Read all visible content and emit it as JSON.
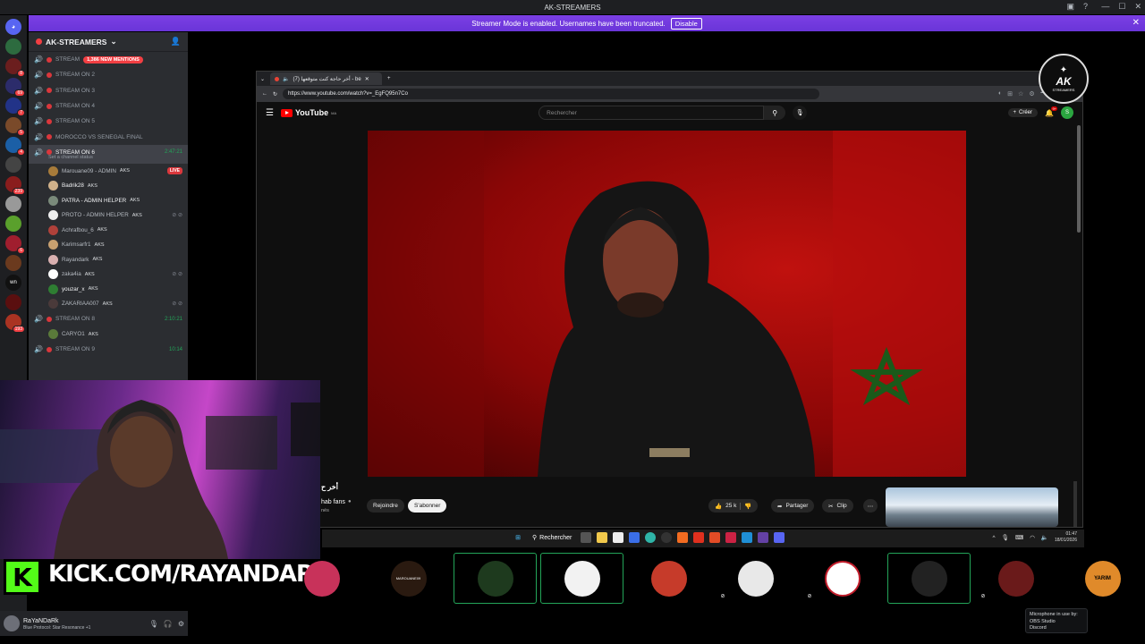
{
  "window": {
    "title": "AK-STREAMERS"
  },
  "banner": {
    "text": "Streamer Mode is enabled. Usernames have been truncated.",
    "button": "Disable"
  },
  "rail": {
    "badges": [
      "8",
      "8",
      "69",
      "7",
      "5",
      "4",
      "239",
      "6",
      "8",
      "wn",
      "193"
    ]
  },
  "server": {
    "name": "AK-STREAMERS"
  },
  "channels": [
    {
      "label": "STREAM",
      "mention": "1,386 NEW MENTIONS"
    },
    {
      "label": "STREAM ON 2"
    },
    {
      "label": "STREAM ON 3"
    },
    {
      "label": "STREAM ON 4"
    },
    {
      "label": "STREAM ON 5"
    },
    {
      "label": "MOROCCO VS SENEGAL FINAL"
    },
    {
      "label": "STREAM ON 6",
      "time": "2:47:21",
      "status": "Set a channel status"
    }
  ],
  "voice_users": [
    {
      "name": "Marouane09 - ADMIN",
      "tag": "AKS",
      "live": "LIVE"
    },
    {
      "name": "Badrik28",
      "tag": "AKS"
    },
    {
      "name": "PATRA - ADMIN HELPER",
      "tag": "AKS"
    },
    {
      "name": "PROTO - ADMIN HELPER",
      "tag": "AKS"
    },
    {
      "name": "Achrafbou_6",
      "tag": "AKS"
    },
    {
      "name": "Karimsarfr1",
      "tag": "AKS"
    },
    {
      "name": "Rayandark",
      "tag": "AKS"
    },
    {
      "name": "zaka4ia",
      "tag": "AKS"
    },
    {
      "name": "youzar_x",
      "tag": "AKS"
    },
    {
      "name": "ZAKARIAA007",
      "tag": "AKS"
    }
  ],
  "channels2": [
    {
      "label": "STREAM ON 8",
      "time": "2:10:21"
    },
    {
      "user": "CARYO1",
      "tag": "AKS"
    },
    {
      "label": "STREAM ON 9",
      "time": "10:14"
    }
  ],
  "browser": {
    "tab_title": "أخر حاجة كنت متوقعها (7) - be",
    "url": "https://www.youtube.com/watch?v=_EgFQ95n7Co"
  },
  "youtube": {
    "logo": "YouTube",
    "region": "MA",
    "search_placeholder": "Rechercher",
    "create": "Créer",
    "notif_count": "9+",
    "avatar_letter": "S",
    "video_title_fragment": "أخر ح",
    "channel": "hab fans",
    "channel_sub": "nés",
    "join": "Rejoindre",
    "subscribe": "S'abonner",
    "likes": "25 k",
    "share": "Partager",
    "clip": "Clip"
  },
  "ak_logo": {
    "big": "AK",
    "small": "STREAMERS"
  },
  "kick": {
    "text": "KICK.COM/RAYANDARK"
  },
  "user": {
    "name": "RaYaNDaRk",
    "status": "Blue Protocol: Star Resonance +1"
  },
  "taskbar": {
    "search": "Rechercher",
    "time": "01:47",
    "date": "18/01/2026"
  },
  "participants": [
    {
      "name": "",
      "bg": "#f1c5c5"
    },
    {
      "name": "MAROUANE09",
      "bg": "#c88e3c"
    },
    {
      "name": "",
      "bg": "#2b6b2e"
    },
    {
      "name": "",
      "bg": "#d9c6c6"
    },
    {
      "name": "",
      "bg": "#cf7a55"
    },
    {
      "name": "",
      "bg": "#8b7e95"
    },
    {
      "name": "",
      "bg": "#f3f3f3"
    },
    {
      "name": "",
      "bg": "#a8a8a8"
    },
    {
      "name": "",
      "bg": "#2a1f23"
    },
    {
      "name": "YARIM",
      "bg": "#000000"
    }
  ],
  "mic_popup": {
    "line1": "Microphone in use by:",
    "line2": "OBS Studio",
    "line3": "Discord"
  }
}
